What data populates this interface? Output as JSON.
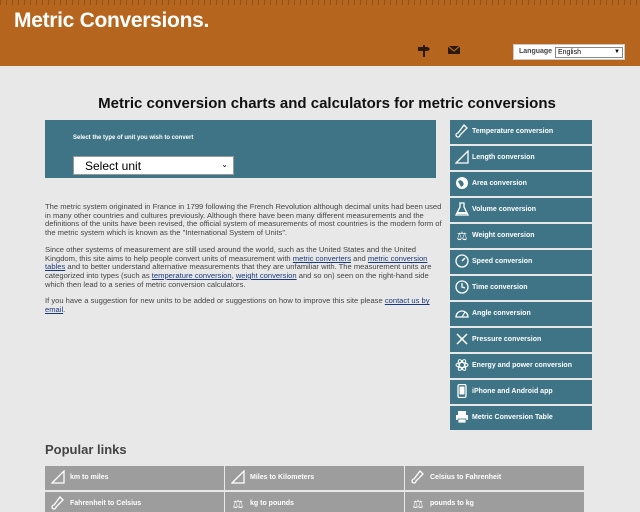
{
  "header": {
    "logo": "Metric Conversions.",
    "language_label": "Language",
    "language_selected": "English",
    "icons": [
      "signpost-icon",
      "mail-icon"
    ]
  },
  "main": {
    "title": "Metric conversion charts and calculators for metric conversions",
    "select_label": "Select the type of unit you wish to convert",
    "select_value": "Select unit",
    "paragraphs": {
      "p1": "The metric system originated in France in 1799 following the French Revolution although decimal units had been used in many other countries and cultures previously. Although there have been many different measurements and the definitions of the units have been revised, the official system of measurements of most countries is the modern form of the metric system which is known as the \"International System of Units\".",
      "p2a": "Since other systems of measurement are still used around the world, such as the United States and the United Kingdom, this site aims to help people convert units of measurement with ",
      "p2_link1": "metric converters",
      "p2b": " and ",
      "p2_link2": "metric conversion tables",
      "p2c": " and to better understand alternative measurements that they are unfamiliar with. The measurement units are categorized into types (such as ",
      "p2_link3": "temperature conversion",
      "p2d": ", ",
      "p2_link4": "weight conversion",
      "p2e": " and so on) seen on the right-hand side which then lead to a series of metric conversion calculators.",
      "p3a": "If you have a suggestion for new units to be added or suggestions on how to improve this site please ",
      "p3_link": "contact us by email",
      "p3b": "."
    }
  },
  "sidebar": {
    "items": [
      {
        "label": "Temperature conversion",
        "icon": "thermometer-icon"
      },
      {
        "label": "Length conversion",
        "icon": "ruler-icon"
      },
      {
        "label": "Area conversion",
        "icon": "globe-icon"
      },
      {
        "label": "Volume conversion",
        "icon": "flask-icon"
      },
      {
        "label": "Weight conversion",
        "icon": "scales-icon"
      },
      {
        "label": "Speed conversion",
        "icon": "speedometer-icon"
      },
      {
        "label": "Time conversion",
        "icon": "clock-icon"
      },
      {
        "label": "Angle conversion",
        "icon": "protractor-icon"
      },
      {
        "label": "Pressure conversion",
        "icon": "pressure-icon"
      },
      {
        "label": "Energy and power conversion",
        "icon": "atom-icon"
      },
      {
        "label": "iPhone and Android app",
        "icon": "phone-icon"
      },
      {
        "label": "Metric Conversion Table",
        "icon": "printer-icon"
      }
    ]
  },
  "popular": {
    "title": "Popular links",
    "items": [
      {
        "label": "km to miles",
        "icon": "ruler-icon"
      },
      {
        "label": "Miles to Kilometers",
        "icon": "ruler-icon"
      },
      {
        "label": "Celsius to Fahrenheit",
        "icon": "thermometer-icon"
      },
      {
        "label": "Fahrenheit to Celsius",
        "icon": "thermometer-icon"
      },
      {
        "label": "kg to pounds",
        "icon": "scales-icon"
      },
      {
        "label": "pounds to kg",
        "icon": "scales-icon"
      }
    ]
  },
  "colors": {
    "header_bg": "#b5651d",
    "panel_bg": "#3e7486",
    "popular_bg": "#9d9d9d",
    "page_bg": "#e8e8e8"
  }
}
